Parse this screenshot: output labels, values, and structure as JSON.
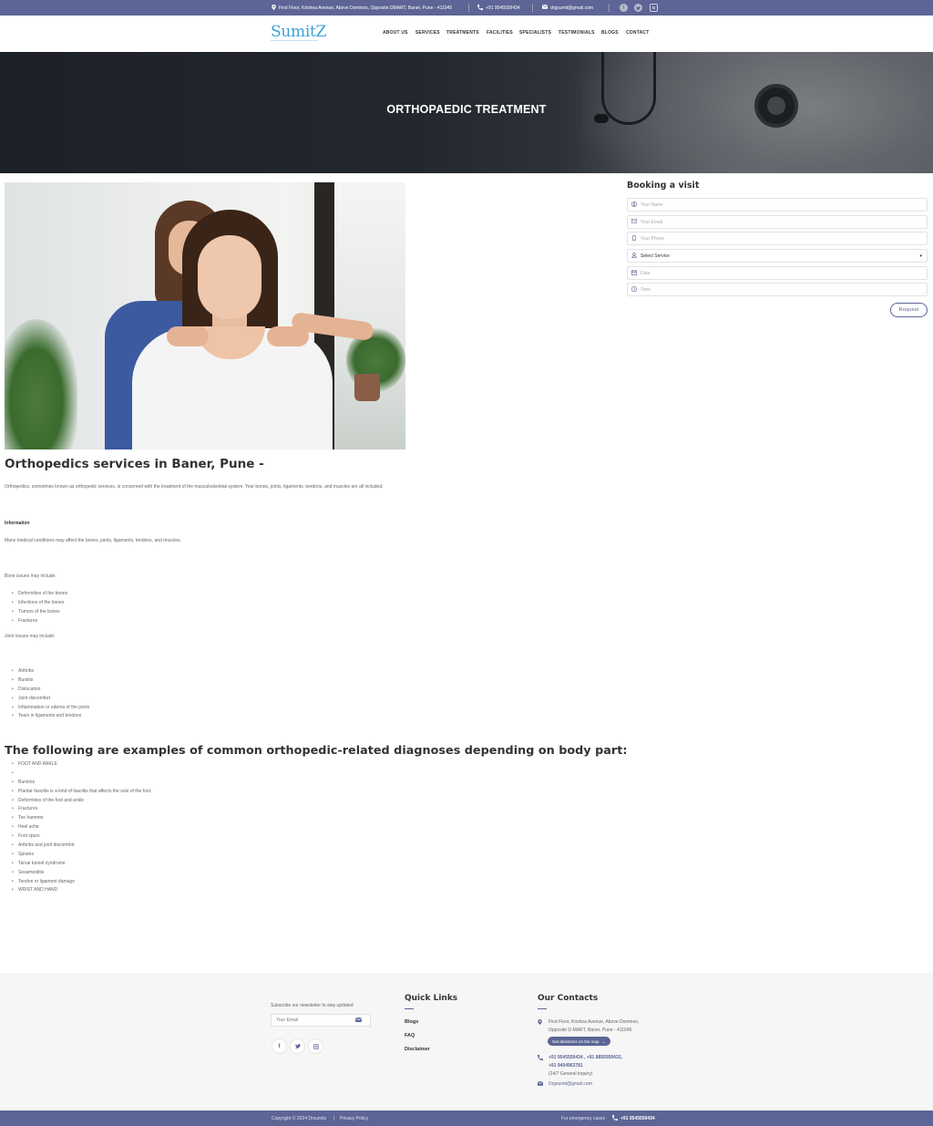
{
  "topbar": {
    "address": "First Floor, Krishna Avenue, Above Dominos, Opposite DMART, Baner, Pune - 411045",
    "phone": "+91 9545559434",
    "email": "drgsumit@gmail.com",
    "social": [
      "facebook-icon",
      "twitter-icon",
      "instagram-icon"
    ]
  },
  "header": {
    "logo": "SumitZ",
    "nav": [
      "ABOUT US",
      "SERVICES",
      "TREATMENTS",
      "FACILITIES",
      "SPECIALISTS",
      "TESTIMONIALS",
      "BLOGS",
      "CONTACT"
    ]
  },
  "banner": {
    "title": "ORTHOPAEDIC TREATMENT"
  },
  "article": {
    "heading": "Orthopedics services in Baner, Pune -",
    "intro": "Orthopedics, sometimes known as orthopedic services, is concerned with the treatment of the musculoskeletal system. Your bones, joints, ligaments, tendons, and muscles are all included.",
    "info_label": "Information",
    "info_text": "Many medical conditions may affect the bones, joints, ligaments, tendons, and muscles.",
    "bone_label": "Bone issues may include:",
    "bone_items": [
      "Deformities of the bones",
      "Infections of the bones",
      "Tumors of the bones",
      "Fractures"
    ],
    "joint_label": "Joint issues may include:",
    "joint_items": [
      "Arthritis",
      "Bursitis",
      "Dislocation",
      "Joint discomfort",
      "Inflammation or edema of the joints",
      "Tears in ligaments and tendons"
    ],
    "examples_heading": "The following are examples of common orthopedic-related diagnoses depending on body part:",
    "example_items": [
      "FOOT AND ANKLE",
      "",
      "Bunions",
      "Plantar fasciitis is a kind of fasciitis that affects the sole of the foot.",
      "Deformities of the foot and ankle",
      "Fractures",
      "Toe hammer",
      "Heel ache",
      "Foot spurs",
      "Arthritis and joint discomfort",
      "Sprains",
      "Tarsal tunnel syndrome",
      "Sesamoiditis",
      "Tendon or ligament damage",
      "WRIST AND HAND"
    ]
  },
  "booking": {
    "title": "Booking a visit",
    "name_placeholder": "Your Name",
    "email_placeholder": "Your Email",
    "phone_placeholder": "Your Phone",
    "service_selected": "Select Service",
    "date_placeholder": "Date",
    "time_placeholder": "Time",
    "submit": "Request"
  },
  "footer": {
    "newsletter_text": "Subscribe our newsletter to stay updated",
    "email_placeholder": "Your Email",
    "quick_links_title": "Quick Links",
    "quick_links": [
      "Blogs",
      "FAQ",
      "Disclaimer"
    ],
    "contacts_title": "Our Contacts",
    "address_line1": "First Floor, Krishna Avenue, Above Dominos,",
    "address_line2": "Opposite D-MART, Baner, Pune - 411045",
    "directions": "Get directions on the map",
    "phones_line1": "+91 9545559434 , +91 8855950433,",
    "phones_line2": "+91 9404963781",
    "phones_note": "(24/7 General inquiry)",
    "email": "Drgsumit@gmail.com"
  },
  "bottombar": {
    "copyright": "Copyright © 2024 Drsumitz",
    "separator": "|",
    "privacy": "Privacy Policy",
    "emergency_label": "For emergency cases",
    "emergency_phone": "+91 9545559434"
  },
  "colors": {
    "brand": "#5c6595",
    "logo": "#3aa2d6"
  }
}
